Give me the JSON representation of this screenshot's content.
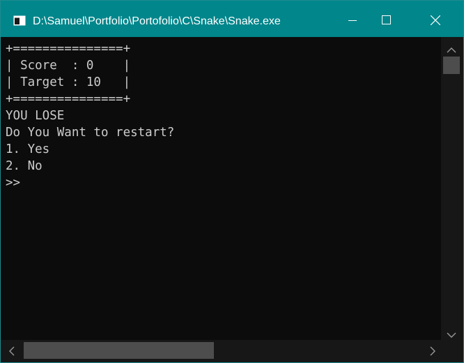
{
  "window": {
    "title": "D:\\Samuel\\Portfolio\\Portofolio\\C\\Snake\\Snake.exe",
    "icons": {
      "app": "console-app-icon",
      "minimize": "minimize-icon",
      "maximize": "maximize-icon",
      "close": "close-icon"
    }
  },
  "console": {
    "lines": [
      "+===============+",
      "| Score  : 0    |",
      "| Target : 10   |",
      "+===============+",
      "YOU LOSE",
      "Do You Want to restart?",
      "1. Yes",
      "2. No",
      ">>"
    ]
  },
  "colors": {
    "titlebar": "#00868b",
    "console_bg": "#0c0c0c",
    "console_text": "#cccccc"
  }
}
